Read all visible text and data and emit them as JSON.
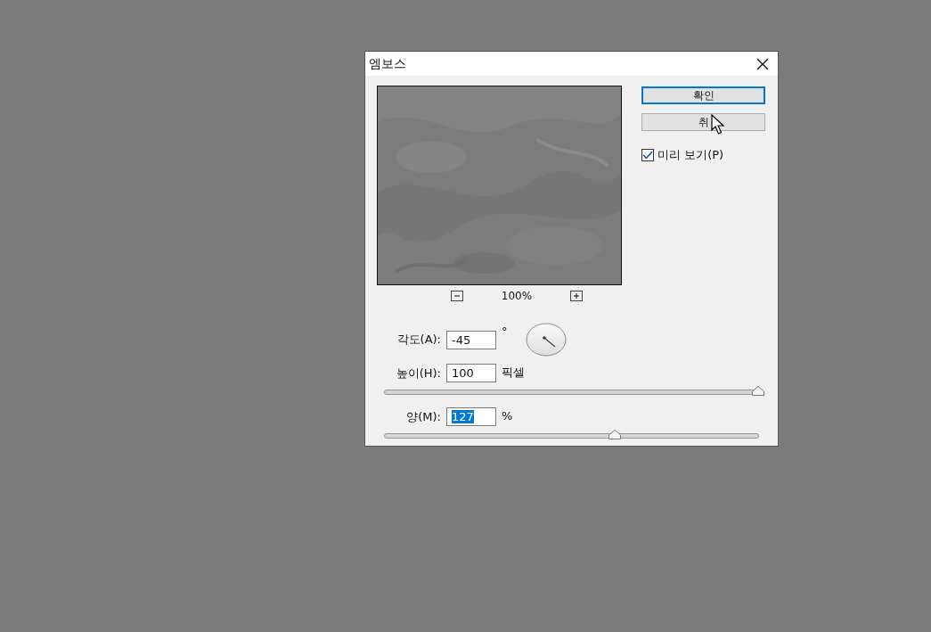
{
  "dialog": {
    "title": "엠보스",
    "preview": {
      "zoom": "100%"
    },
    "buttons": [
      {
        "label": "확인",
        "default": true
      },
      {
        "label": "취",
        "default": false
      }
    ],
    "preview_checkbox": {
      "label": "미리 보기(P)",
      "checked": true
    },
    "fields": [
      {
        "kind": "dial",
        "label": "각도(A):",
        "value": "-45",
        "unit": "°",
        "selected": false
      },
      {
        "kind": "slider",
        "label": "높이(H):",
        "value": "100",
        "unit": "픽셀",
        "selected": false,
        "level": 1.0
      },
      {
        "kind": "slider",
        "label": "양(M):",
        "value": "127",
        "unit": "%",
        "selected": true,
        "level": 0.615
      }
    ]
  }
}
